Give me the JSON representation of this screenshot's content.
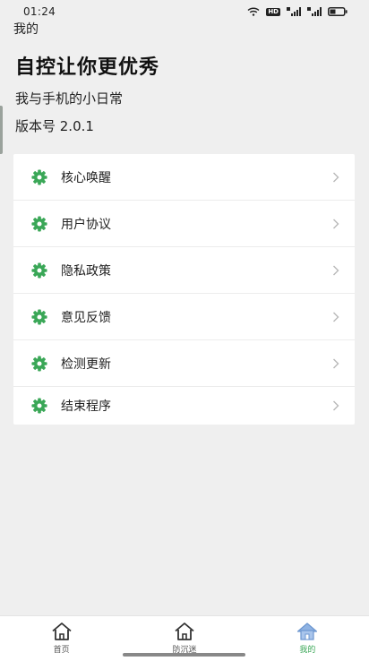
{
  "status_bar": {
    "time": "01:24",
    "hd_badge": "HD",
    "icons": [
      "wifi-icon",
      "hd-icon",
      "signal-4g-icon",
      "signal-4g-icon",
      "battery-icon"
    ]
  },
  "header": {
    "small_title": "我的",
    "title": "自控让你更优秀",
    "subtitle": "我与手机的小日常",
    "version": "版本号 2.0.1"
  },
  "menu": {
    "items": [
      {
        "label": "核心唤醒",
        "icon": "gear-icon"
      },
      {
        "label": "用户协议",
        "icon": "gear-icon"
      },
      {
        "label": "隐私政策",
        "icon": "gear-icon"
      },
      {
        "label": "意见反馈",
        "icon": "gear-icon"
      },
      {
        "label": "检测更新",
        "icon": "gear-icon"
      },
      {
        "label": "结束程序",
        "icon": "gear-icon"
      }
    ]
  },
  "tabs": [
    {
      "label": "首页",
      "icon": "home-icon",
      "active": false
    },
    {
      "label": "防沉迷",
      "icon": "home-icon",
      "active": false
    },
    {
      "label": "我的",
      "icon": "home-icon",
      "active": true
    }
  ],
  "colors": {
    "accent": "#3aa757",
    "active_tab": "#8fb3e3",
    "background": "#efefef"
  }
}
